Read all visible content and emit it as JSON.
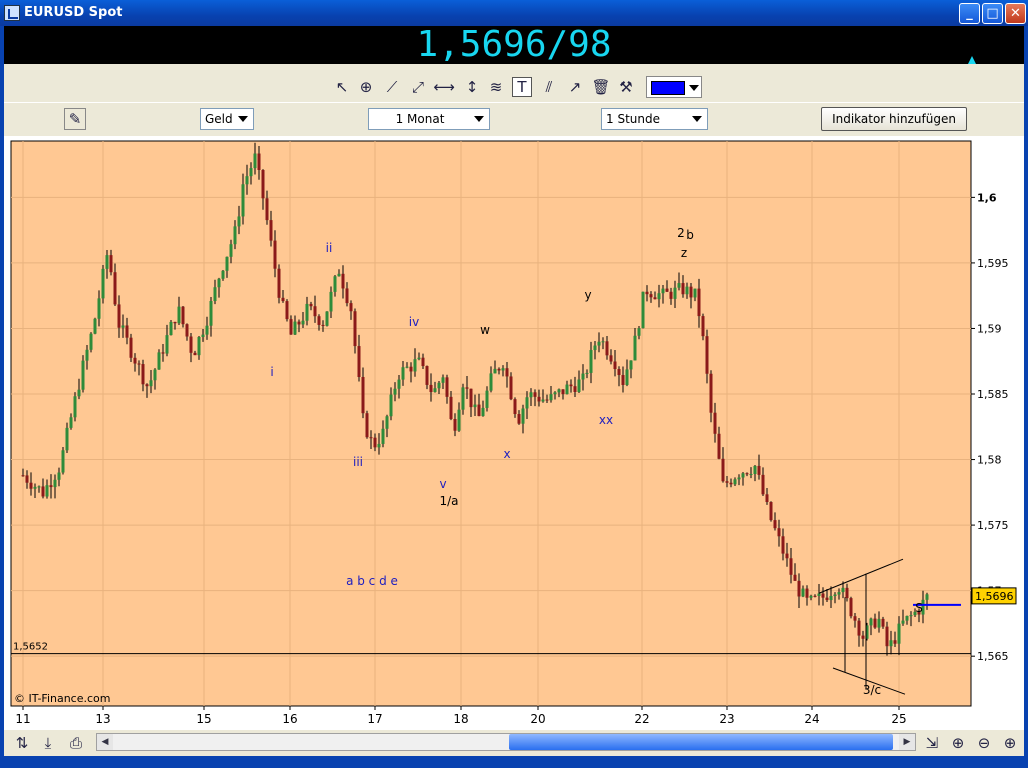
{
  "window": {
    "title": "EURUSD Spot",
    "btn_min": "_",
    "btn_max": "□",
    "btn_close": "✕"
  },
  "price_display": "1,5696/98",
  "toolbar": {
    "line_color": "#0000ff"
  },
  "controls": {
    "price_type": "Geld",
    "period": "1 Monat",
    "interval": "1 Stunde",
    "add_indicator": "Indikator hinzufügen"
  },
  "chart_data": {
    "type": "candlestick",
    "background": "#ffc893",
    "credit": "© IT-Finance.com",
    "x_tick_labels": [
      "11",
      "13",
      "15",
      "16",
      "17",
      "18",
      "20",
      "22",
      "23",
      "24",
      "25"
    ],
    "y_tick_labels": [
      "1,565",
      "1,57",
      "1,575",
      "1,58",
      "1,585",
      "1,59",
      "1,595",
      "1,6"
    ],
    "y_ticks": [
      1.565,
      1.57,
      1.575,
      1.58,
      1.585,
      1.59,
      1.595,
      1.6
    ],
    "ylim": [
      1.5612,
      1.6043
    ],
    "grid": true,
    "current_price_label": "1,5696",
    "current_price": 1.5696,
    "reference_line_label": "1,5652",
    "reference_line": 1.5652,
    "close_path": [
      [
        0,
        1.5788
      ],
      [
        20,
        1.5775
      ],
      [
        37,
        1.5795
      ],
      [
        58,
        1.5865
      ],
      [
        70,
        1.59
      ],
      [
        85,
        1.596
      ],
      [
        95,
        1.5905
      ],
      [
        110,
        1.588
      ],
      [
        125,
        1.5855
      ],
      [
        140,
        1.5885
      ],
      [
        155,
        1.5915
      ],
      [
        170,
        1.588
      ],
      [
        185,
        1.591
      ],
      [
        198,
        1.5945
      ],
      [
        213,
        1.5975
      ],
      [
        220,
        1.601
      ],
      [
        232,
        1.603
      ],
      [
        240,
        1.6
      ],
      [
        250,
        1.5955
      ],
      [
        258,
        1.592
      ],
      [
        268,
        1.5895
      ],
      [
        285,
        1.5915
      ],
      [
        300,
        1.5905
      ],
      [
        316,
        1.5945
      ],
      [
        328,
        1.5915
      ],
      [
        340,
        1.583
      ],
      [
        350,
        1.581
      ],
      [
        360,
        1.582
      ],
      [
        375,
        1.5865
      ],
      [
        395,
        1.5875
      ],
      [
        410,
        1.585
      ],
      [
        420,
        1.5865
      ],
      [
        430,
        1.582
      ],
      [
        440,
        1.586
      ],
      [
        455,
        1.583
      ],
      [
        470,
        1.5865
      ],
      [
        480,
        1.5875
      ],
      [
        495,
        1.583
      ],
      [
        505,
        1.585
      ],
      [
        525,
        1.5845
      ],
      [
        545,
        1.5855
      ],
      [
        560,
        1.586
      ],
      [
        575,
        1.5895
      ],
      [
        592,
        1.5875
      ],
      [
        600,
        1.586
      ],
      [
        612,
        1.589
      ],
      [
        622,
        1.593
      ],
      [
        640,
        1.5925
      ],
      [
        660,
        1.593
      ],
      [
        672,
        1.5925
      ],
      [
        678,
        1.5905
      ],
      [
        688,
        1.5835
      ],
      [
        700,
        1.578
      ],
      [
        715,
        1.579
      ],
      [
        732,
        1.5795
      ],
      [
        745,
        1.576
      ],
      [
        760,
        1.573
      ],
      [
        772,
        1.5705
      ],
      [
        785,
        1.569
      ],
      [
        800,
        1.5695
      ],
      [
        815,
        1.5705
      ],
      [
        828,
        1.5685
      ],
      [
        840,
        1.5665
      ],
      [
        855,
        1.568
      ],
      [
        865,
        1.5655
      ],
      [
        880,
        1.5675
      ],
      [
        895,
        1.5685
      ],
      [
        905,
        1.5696
      ]
    ],
    "annotations": [
      {
        "text": "i",
        "color": "#2020c0"
      },
      {
        "text": "ii",
        "color": "#2020c0"
      },
      {
        "text": "iii",
        "color": "#2020c0"
      },
      {
        "text": "iv",
        "color": "#2020c0"
      },
      {
        "text": "v",
        "color": "#2020c0"
      },
      {
        "text": "1/a",
        "color": "#000000"
      },
      {
        "text": "w",
        "color": "#000000"
      },
      {
        "text": "x",
        "color": "#2020c0"
      },
      {
        "text": "y",
        "color": "#000000"
      },
      {
        "text": "xx",
        "color": "#2020c0"
      },
      {
        "text": "2",
        "color": "#000000"
      },
      {
        "text": "b",
        "color": "#000000"
      },
      {
        "text": "z",
        "color": "#000000"
      },
      {
        "text": "a b c d e",
        "color": "#2020c0"
      },
      {
        "text": "3/c",
        "color": "#000000"
      },
      {
        "text": "S",
        "color": "#000000"
      }
    ]
  }
}
